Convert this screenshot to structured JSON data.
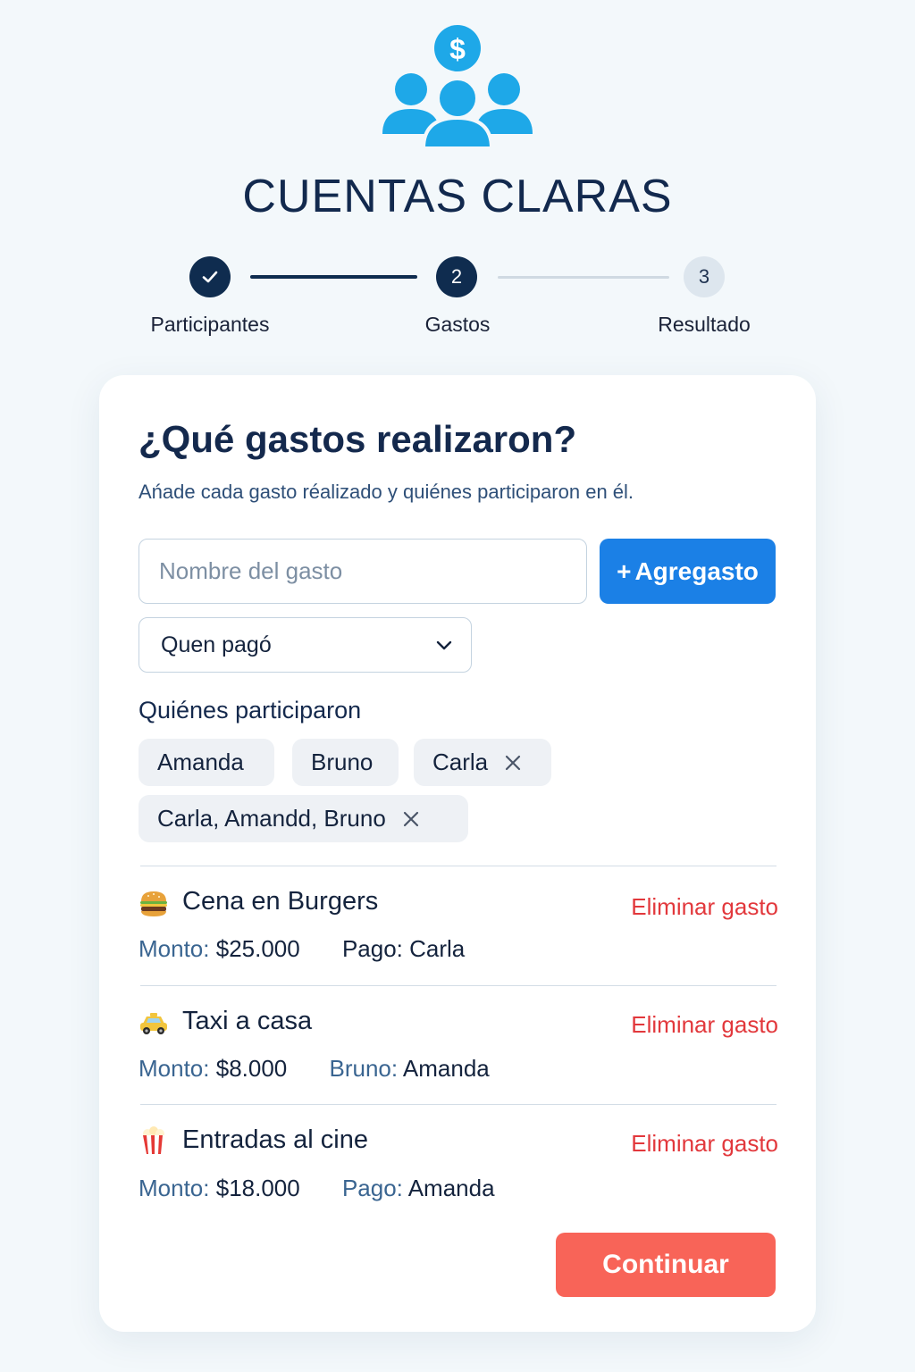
{
  "app": {
    "title": "CUENTAS CLARAS"
  },
  "colors": {
    "brand_blue": "#1ea8e8",
    "navy": "#0f2c4f",
    "primary_button": "#1b80e6",
    "danger_text": "#e2383c",
    "continue_button": "#f86458"
  },
  "stepper": {
    "steps": [
      {
        "label": "Participantes",
        "number": "",
        "state": "done",
        "icon": "check-icon"
      },
      {
        "label": "Gastos",
        "number": "2",
        "state": "active"
      },
      {
        "label": "Resultado",
        "number": "3",
        "state": "todo"
      }
    ]
  },
  "card": {
    "title": "¿Qué gastos realizaron?",
    "subtitle": "Ańade cada gasto réalizado y quiénes participaron en él."
  },
  "form": {
    "expense_name_placeholder": "Nombre del gasto",
    "add_button_icon": "+",
    "add_button_label": "Agregasto",
    "payer_select_value": "Quen pagó",
    "participants_label": "Quiénes participaron",
    "participant_chips": [
      {
        "label": "Amanda",
        "removable": false
      },
      {
        "label": "Bruno",
        "removable": false
      },
      {
        "label": "Carla",
        "removable": true
      },
      {
        "label": "Carla, Amandd, Bruno",
        "removable": true
      }
    ]
  },
  "expenses": [
    {
      "icon": "burger-icon",
      "name": "Cena en Burgers",
      "delete_label": "Eliminar gasto",
      "amount_key": "Monto:",
      "amount_value": "$25.000",
      "payer_key": "Pago:",
      "payer_value": "Carla"
    },
    {
      "icon": "taxi-icon",
      "name": "Taxi a casa",
      "delete_label": "Eliminar gasto",
      "amount_key": "Monto:",
      "amount_value": "$8.000",
      "payer_key": "Bruno:",
      "payer_value": "Amanda"
    },
    {
      "icon": "popcorn-icon",
      "name": "Entradas al cine",
      "delete_label": "Eliminar gasto",
      "amount_key": "Monto:",
      "amount_value": "$18.000",
      "payer_key": "Pago:",
      "payer_value": "Amanda"
    }
  ],
  "actions": {
    "continue_label": "Continuar"
  }
}
